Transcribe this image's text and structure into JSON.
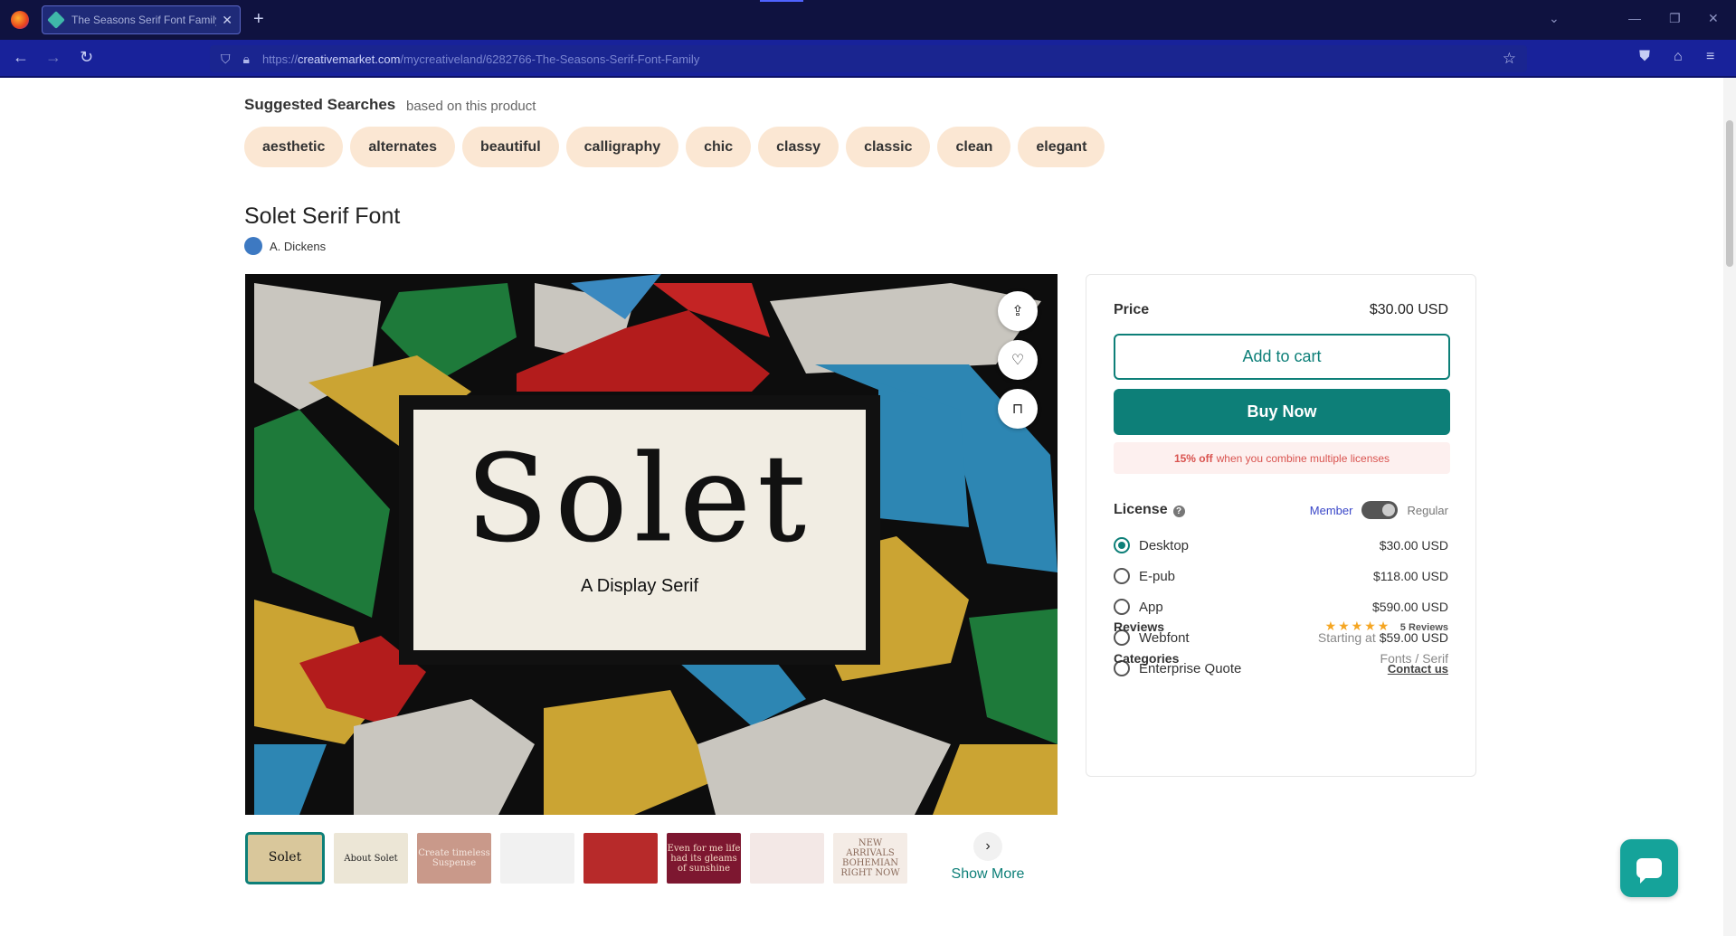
{
  "browser": {
    "tab_title": "The Seasons Serif Font Family",
    "url_prefix": "https://",
    "url_host": "creativemarket.com",
    "url_path": "/mycreativeland/6282766-The-Seasons-Serif-Font-Family"
  },
  "suggested": {
    "title": "Suggested Searches",
    "subtitle": "based on this product",
    "chips": [
      "aesthetic",
      "alternates",
      "beautiful",
      "calligraphy",
      "chic",
      "classy",
      "classic",
      "clean",
      "elegant"
    ]
  },
  "product": {
    "title": "Solet Serif Font",
    "author": "A. Dickens",
    "hero_word": "Solet",
    "hero_subtitle": "A Display Serif"
  },
  "thumbnails": [
    {
      "text": "Solet",
      "bg": "#d9c79b",
      "fg": "#111"
    },
    {
      "text": "About Solet",
      "bg": "#ece6d6",
      "fg": "#222"
    },
    {
      "text": "Create timeless Suspense",
      "bg": "#c9998a",
      "fg": "#f4e6df"
    },
    {
      "text": "",
      "bg": "#f1f1f1",
      "fg": "#333"
    },
    {
      "text": "",
      "bg": "#b72a2a",
      "fg": "#f3d9d0"
    },
    {
      "text": "Even for me life had its gleams of sunshine",
      "bg": "#7d1730",
      "fg": "#f5d8c4"
    },
    {
      "text": "",
      "bg": "#f3e8e6",
      "fg": "#c98a86"
    },
    {
      "text": "NEW ARRIVALS BOHEMIAN RIGHT NOW",
      "bg": "#f4ece6",
      "fg": "#8a6a5a"
    }
  ],
  "show_more": "Show More",
  "pricing": {
    "price_label": "Price",
    "price_value": "$30.00 USD",
    "add_to_cart": "Add to cart",
    "buy_now": "Buy Now",
    "promo_bold": "15% off",
    "promo_text": "when you combine multiple licenses",
    "license_label": "License",
    "help": "?",
    "member": "Member",
    "regular": "Regular",
    "licenses": [
      {
        "name": "Desktop",
        "prefix": "",
        "price": "$30.00 USD",
        "selected": true
      },
      {
        "name": "E-pub",
        "prefix": "",
        "price": "$118.00 USD",
        "selected": false
      },
      {
        "name": "App",
        "prefix": "",
        "price": "$590.00 USD",
        "selected": false
      },
      {
        "name": "Webfont",
        "prefix": "Starting at",
        "price": "$59.00 USD",
        "selected": false
      },
      {
        "name": "Enterprise Quote",
        "prefix": "",
        "price": "Contact us",
        "selected": false
      }
    ],
    "reviews_label": "Reviews",
    "stars": "★★★★★",
    "reviews_count": "5 Reviews",
    "categories_label": "Categories",
    "categories_value": "Fonts / Serif"
  },
  "colors": {
    "accent": "#0d7f78",
    "chip_bg": "#fbe7d3",
    "browser_bar": "#18229a"
  }
}
